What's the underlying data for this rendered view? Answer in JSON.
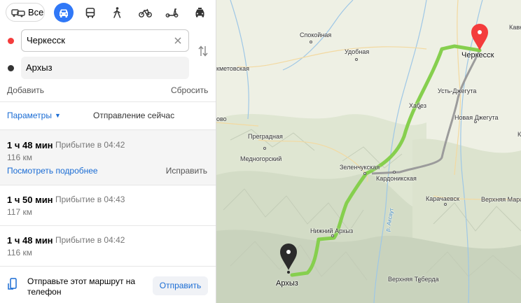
{
  "modes": {
    "all_label": "Все",
    "items": [
      "car-icon",
      "bus-icon",
      "walk-icon",
      "bike-icon",
      "scooter-icon",
      "taxi-icon"
    ],
    "active": "car-icon",
    "accent": "#3078f7"
  },
  "route_form": {
    "from_value": "Черкесск",
    "to_value": "Архыз",
    "from_color": "#f43c3c",
    "to_color": "#333333",
    "add_label": "Добавить",
    "reset_label": "Сбросить"
  },
  "options": {
    "params_label": "Параметры",
    "departure_label": "Отправление сейчас"
  },
  "routes": [
    {
      "time": "1 ч 48 мин",
      "arrival": "Прибытие в 04:42",
      "distance": "116 км",
      "details": "Посмотреть подробнее",
      "fix": "Исправить"
    },
    {
      "time": "1 ч 50 мин",
      "arrival": "Прибытие в 04:43",
      "distance": "117 км"
    },
    {
      "time": "1 ч 48 мин",
      "arrival": "Прибытие в 04:42",
      "distance": "116 км"
    }
  ],
  "send": {
    "text": "Отправьте этот маршрут на телефон",
    "button": "Отправить"
  },
  "map": {
    "labels": {
      "cherkessk": "Черкесск",
      "arkhyz": "Архыз",
      "kavk": "Кавк",
      "spokoynaya": "Спокойная",
      "udobnaya": "Удобная",
      "kmetovskaya": "кметовская",
      "ust_dzheguta": "Усть-Джегута",
      "khabez": "Хабез",
      "novaya_dzheguta": "Новая Джегута",
      "ovo": "ово",
      "pregradnaya": "Преградная",
      "mednogorsky": "Медногорский",
      "zelenchukskaya": "Зеленчукская",
      "kardonikskaya": "Кардоникская",
      "karachaevsk": "Карачаевск",
      "verkhnyaya_mara": "Верхняя Мара",
      "nizhny_arkhyz": "Нижний Архыз",
      "river_aksaut": "р. Аксаут",
      "verkhnyaya_teberda": "Верхняя Теберда",
      "k": "К"
    },
    "route_active_color": "#86cf4e",
    "route_alt_color": "#999999",
    "pin_start_color": "#f43c3c",
    "pin_end_color": "#2b2b2b"
  }
}
